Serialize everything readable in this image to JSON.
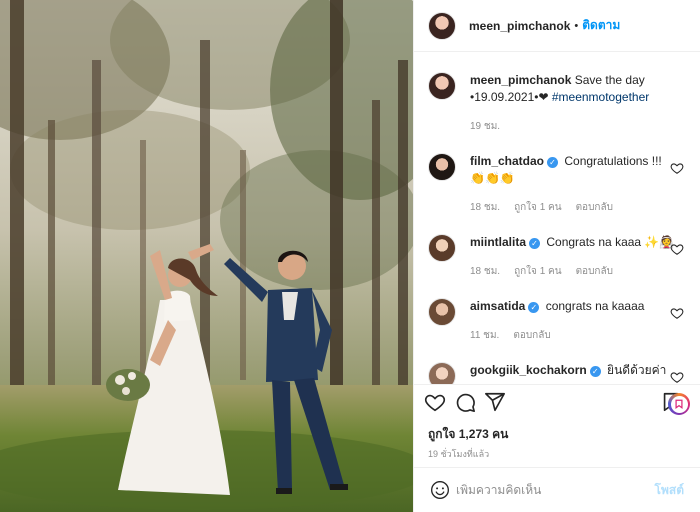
{
  "header": {
    "username": "meen_pimchanok",
    "separator": "•",
    "follow_label": "ติดตาม"
  },
  "caption": {
    "username": "meen_pimchanok",
    "text": "Save the day •19.09.2021•❤",
    "hashtag": "#meenmotogether",
    "time": "19 ชม."
  },
  "comments": [
    {
      "username": "film_chatdao",
      "verified": true,
      "text": "Congratulations !!! 👏👏👏",
      "time": "18 ชม.",
      "likes": "ถูกใจ 1 คน",
      "reply": "ตอบกลับ"
    },
    {
      "username": "miintlalita",
      "verified": true,
      "text": "Congrats na kaaa ✨👰",
      "time": "18 ชม.",
      "likes": "ถูกใจ 1 คน",
      "reply": "ตอบกลับ"
    },
    {
      "username": "aimsatida",
      "verified": true,
      "text": "congrats na kaaaa",
      "time": "11 ชม.",
      "likes": "",
      "reply": "ตอบกลับ"
    },
    {
      "username": "gookgiik_kochakorn",
      "verified": true,
      "text": "ยินดีด้วยค่า",
      "time": "",
      "likes": "",
      "reply": ""
    }
  ],
  "likes_label": "ถูกใจ 1,273 คน",
  "posted_label": "19 ชั่วโมงที่แล้ว",
  "add_comment": {
    "placeholder": "เพิ่มความคิดเห็น",
    "post_label": "โพสต์"
  },
  "icons": {
    "like": "heart-icon",
    "comment": "comment-icon",
    "share": "paper-plane-icon",
    "save": "bookmark-icon",
    "emoji": "smile-icon",
    "comment_like": "heart-icon"
  },
  "colors": {
    "accent": "#0095f6",
    "hashtag": "#00376b",
    "muted": "#8e8e8e",
    "verified": "#3897f0"
  }
}
